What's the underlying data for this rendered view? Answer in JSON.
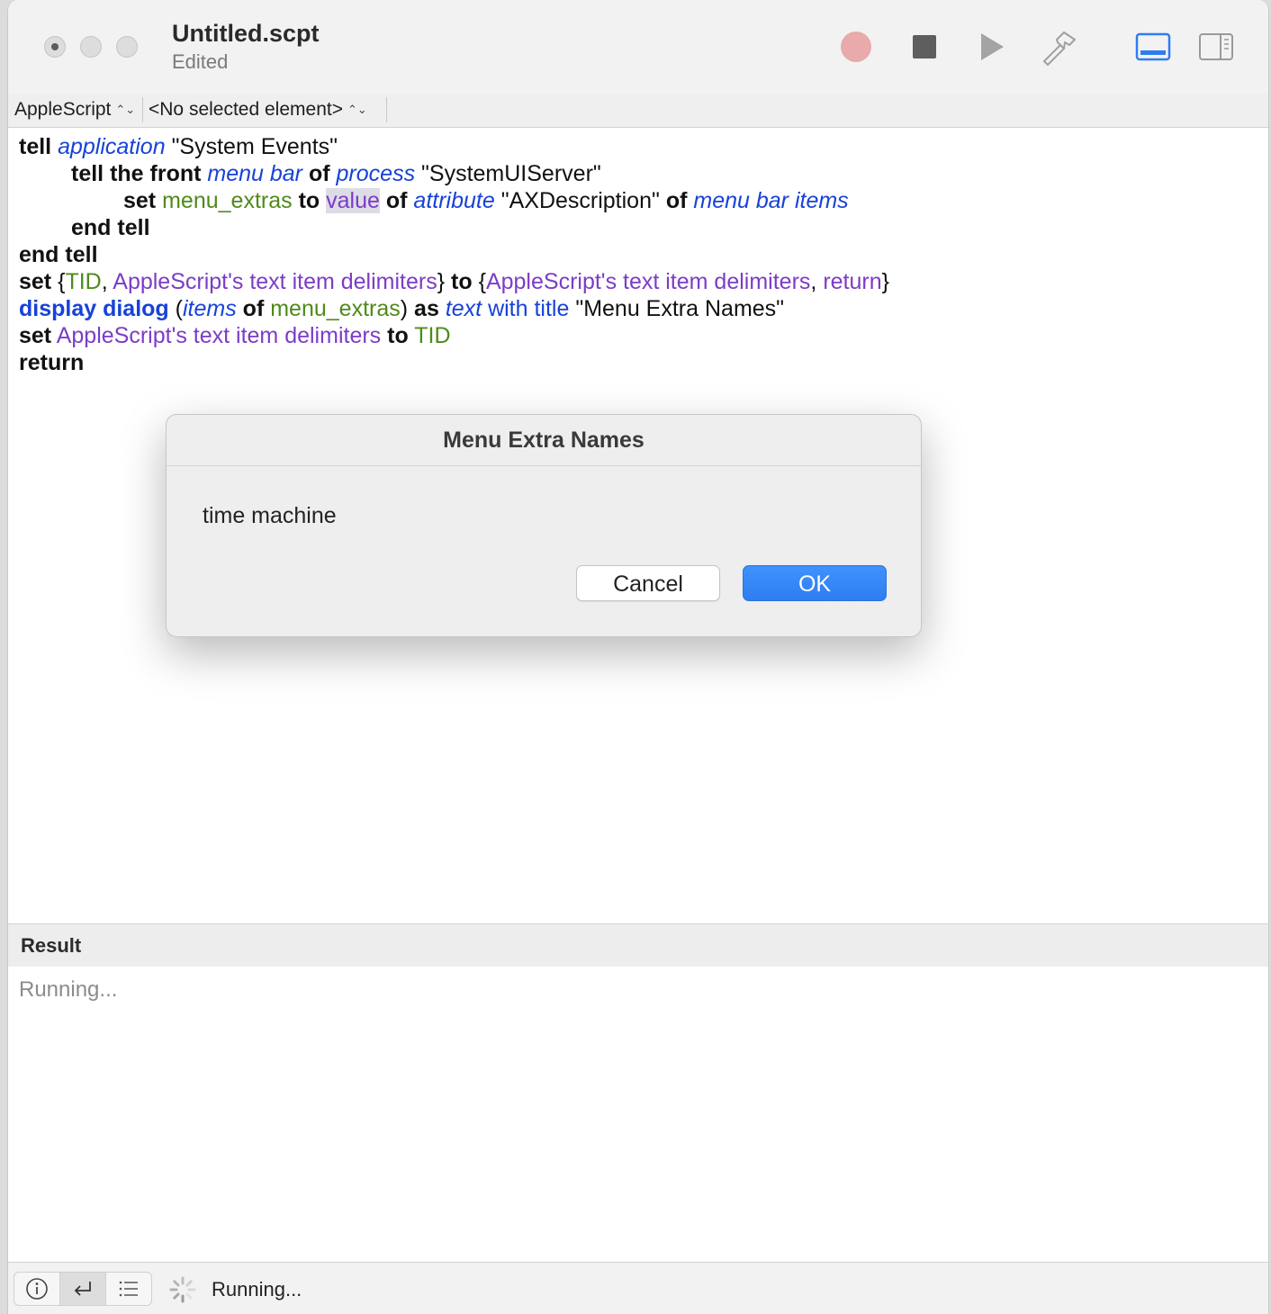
{
  "window": {
    "title": "Untitled.scpt",
    "subtitle": "Edited"
  },
  "toolbar": {
    "record_icon": "record-icon",
    "stop_icon": "stop-icon",
    "run_icon": "play-icon",
    "compile_icon": "hammer-icon",
    "panel_icons": [
      "bottom-panel-icon",
      "side-panel-icon"
    ]
  },
  "navbar": {
    "language": "AppleScript",
    "element": "<No selected element>",
    "chevron": "⌃⌄"
  },
  "code": {
    "l1": {
      "t1": "tell",
      "t2": "application",
      "t3": "\"System Events\""
    },
    "l2": {
      "t1": "tell the front",
      "t2": "menu bar",
      "t3": "of",
      "t4": "process",
      "t5": "\"SystemUIServer\""
    },
    "l3": {
      "t1": "set",
      "t2": "menu_extras",
      "t3": "to",
      "t4": "value",
      "t5": "of",
      "t6": "attribute",
      "t7": "\"AXDescription\"",
      "t8": "of",
      "t9": "menu bar items"
    },
    "l4": {
      "t1": "end tell"
    },
    "l5": {
      "t1": "end tell"
    },
    "l6": {
      "t1": "set",
      "t2": "{",
      "t3": "TID",
      "t4": ",",
      "t5": "AppleScript's text item delimiters",
      "t6": "}",
      "t7": "to",
      "t8": "{",
      "t9": "AppleScript's text item delimiters",
      "t10": ",",
      "t11": "return",
      "t12": "}"
    },
    "l7": {
      "t1": "display dialog",
      "t2": "(",
      "t3": "items",
      "t4": "of",
      "t5": "menu_extras",
      "t6": ")",
      "t7": "as",
      "t8": "text",
      "t9": "with title",
      "t10": "\"Menu Extra Names\""
    },
    "l8": {
      "t1": "set",
      "t2": "AppleScript's text item delimiters",
      "t3": "to",
      "t4": "TID"
    },
    "l9": {
      "t1": "return"
    }
  },
  "result": {
    "header": "Result",
    "text": "Running..."
  },
  "statusbar": {
    "status": "Running..."
  },
  "dialog": {
    "title": "Menu Extra Names",
    "message": "time machine",
    "cancel_label": "Cancel",
    "ok_label": "OK"
  },
  "colors": {
    "accent": "#2f7cf2",
    "keyword": "#111111",
    "class": "#1742d8",
    "variable": "#4f8a1a",
    "property": "#7c3cc6",
    "record": "#e8aaaa"
  }
}
